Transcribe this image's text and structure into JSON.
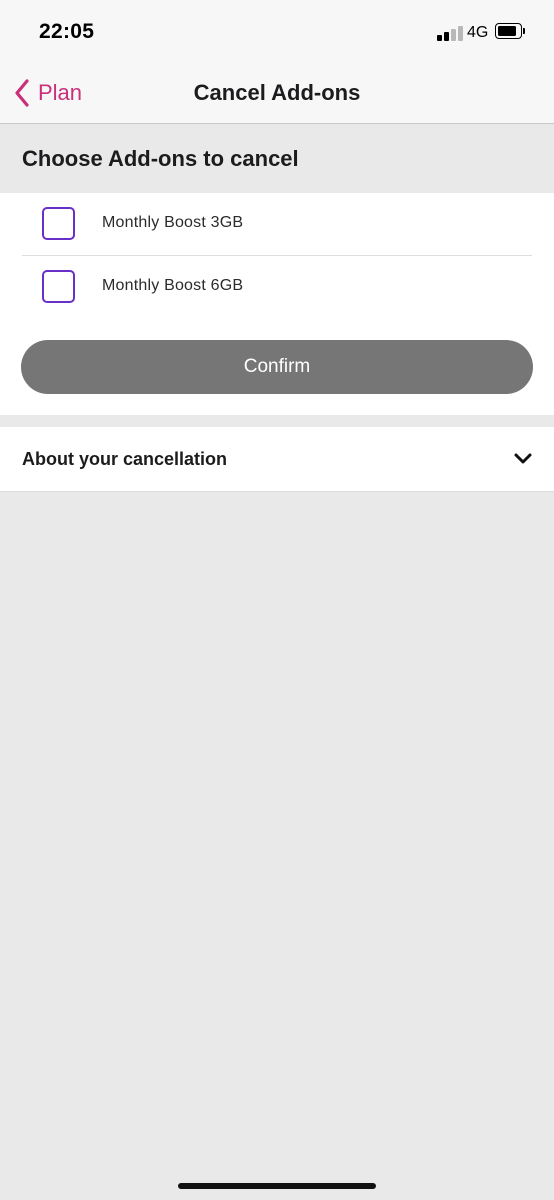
{
  "status_bar": {
    "time": "22:05",
    "network": "4G",
    "signal_bars": 4,
    "signal_bars_active": 2,
    "battery_level": 0.75,
    "icons": [
      "signal-icon",
      "battery-icon"
    ]
  },
  "nav": {
    "back_label": "Plan",
    "back_icon": "chevron-left-icon",
    "title": "Cancel Add-ons"
  },
  "section": {
    "title": "Choose Add-ons to cancel"
  },
  "addons": [
    {
      "label": "Monthly Boost 3GB",
      "checked": false
    },
    {
      "label": "Monthly Boost 6GB",
      "checked": false
    }
  ],
  "confirm": {
    "label": "Confirm",
    "enabled": false
  },
  "accordion": {
    "title": "About your cancellation",
    "icon": "chevron-down-icon",
    "expanded": false
  },
  "colors": {
    "accent_pink": "#c8307a",
    "checkbox_purple": "#6a2fc7",
    "button_disabled": "#767676",
    "background": "#e9e9e9"
  }
}
